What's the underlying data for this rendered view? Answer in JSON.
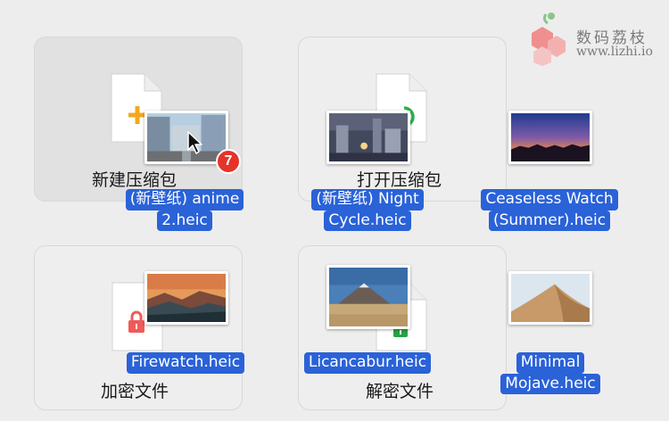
{
  "watermark": {
    "title": "数码荔枝",
    "url": "www.lizhi.io"
  },
  "tiles": [
    {
      "label": "新建压缩包",
      "icon": "new-archive-plus-icon"
    },
    {
      "label": "打开压缩包",
      "icon": "open-archive-arrow-icon"
    },
    {
      "label": "加密文件",
      "icon": "lock-icon"
    },
    {
      "label": "解密文件",
      "icon": "unlock-icon"
    }
  ],
  "drag": {
    "badge_count": "7"
  },
  "files": [
    {
      "line1": "(新壁纸) anime",
      "line2": "2.heic"
    },
    {
      "line1": "(新壁纸) Night",
      "line2": "Cycle.heic"
    },
    {
      "line1": "Ceaseless Watch",
      "line2": "(Summer).heic"
    },
    {
      "line1": "Firewatch.heic"
    },
    {
      "line1": "Licancabur.heic"
    },
    {
      "line1": "Minimal",
      "line2": "Mojave.heic"
    }
  ],
  "colors": {
    "selection": "#2a62d8",
    "badge": "#e5332a",
    "plus": "#f2a81d",
    "arrow": "#2bb24c",
    "lock": "#f05a5a",
    "unlock": "#25a244"
  }
}
